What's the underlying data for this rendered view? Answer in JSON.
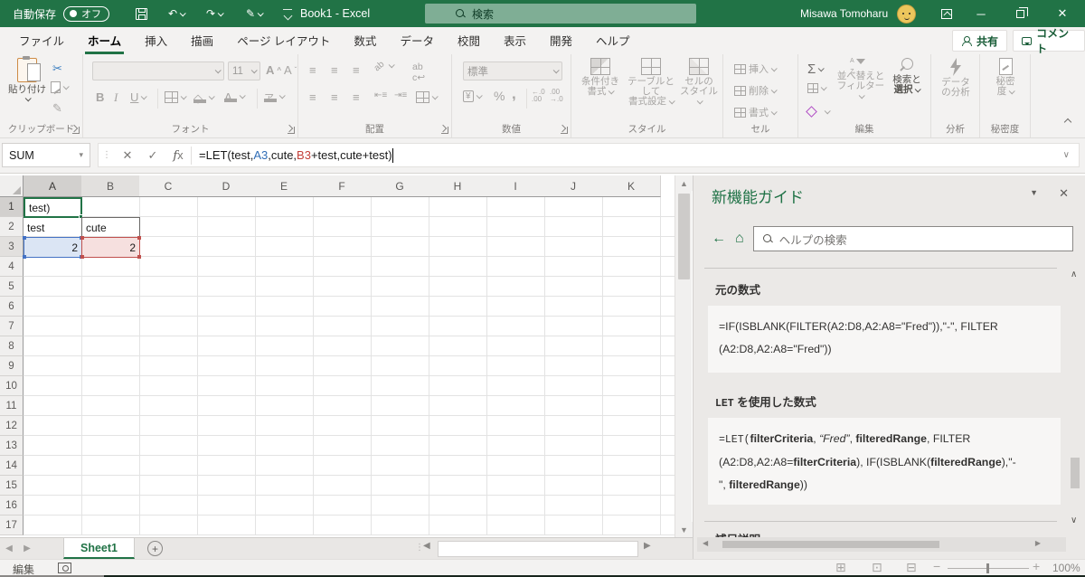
{
  "title_bar": {
    "autosave_label": "自動保存",
    "autosave_state": "オフ",
    "workbook_title": "Book1  -  Excel",
    "search_placeholder": "検索",
    "user_name": "Misawa Tomoharu"
  },
  "tabs": {
    "items": [
      {
        "label": "ファイル",
        "active": false
      },
      {
        "label": "ホーム",
        "active": true
      },
      {
        "label": "挿入",
        "active": false
      },
      {
        "label": "描画",
        "active": false
      },
      {
        "label": "ページ レイアウト",
        "active": false
      },
      {
        "label": "数式",
        "active": false
      },
      {
        "label": "データ",
        "active": false
      },
      {
        "label": "校閲",
        "active": false
      },
      {
        "label": "表示",
        "active": false
      },
      {
        "label": "開発",
        "active": false
      },
      {
        "label": "ヘルプ",
        "active": false
      }
    ],
    "share_label": "共有",
    "comments_label": "コメント"
  },
  "ribbon": {
    "clipboard": {
      "paste": "貼り付け",
      "label": "クリップボード"
    },
    "font": {
      "size": "11",
      "label": "フォント"
    },
    "alignment": {
      "label": "配置"
    },
    "number": {
      "format": "標準",
      "label": "数値"
    },
    "styles": {
      "b1a": "条件付き",
      "b1b": "書式 ",
      "b2a": "テーブルとして",
      "b2b": "書式設定 ",
      "b3a": "セルの",
      "b3b": "スタイル ",
      "label": "スタイル"
    },
    "cells": {
      "b1": "挿入",
      "b2": "削除",
      "b3": "書式",
      "label": "セル"
    },
    "editing": {
      "b1a": "並べ替えと",
      "b1b": "フィルター ",
      "b2a": "検索と",
      "b2b": "選択 ",
      "label": "編集"
    },
    "analysis": {
      "b1a": "データ",
      "b1b": "の分析",
      "label": "分析"
    },
    "sensitivity": {
      "b1a": "秘密",
      "b1b": "度 ",
      "label": "秘密度"
    }
  },
  "formula_bar": {
    "name_box": "SUM",
    "segments": [
      {
        "t": "=LET(test,"
      },
      {
        "t": "A3",
        "c": "#2f6db6"
      },
      {
        "t": ",cute,"
      },
      {
        "t": "B3",
        "c": "#c4403a"
      },
      {
        "t": "+test,cute+test)"
      }
    ]
  },
  "grid": {
    "columns": [
      "A",
      "B",
      "C",
      "D",
      "E",
      "F",
      "G",
      "H",
      "I",
      "J",
      "K"
    ],
    "rows": [
      "1",
      "2",
      "3",
      "4",
      "5",
      "6",
      "7",
      "8",
      "9",
      "10",
      "11",
      "12",
      "13",
      "14",
      "15",
      "16",
      "17"
    ],
    "highlight": {
      "cols": [
        "A"
      ],
      "cols2": [
        "B"
      ],
      "rows": [
        "1"
      ],
      "rows2": [
        "3"
      ]
    },
    "cells": [
      {
        "ref": "A1",
        "text": "test)",
        "c": 0,
        "r": 0,
        "style": "active",
        "align": "left"
      },
      {
        "ref": "A2",
        "text": "test",
        "c": 0,
        "r": 1,
        "style": "plain",
        "align": "left"
      },
      {
        "ref": "B2",
        "text": "cute",
        "c": 1,
        "r": 1,
        "style": "dark",
        "align": "left"
      },
      {
        "ref": "A3",
        "text": "2",
        "c": 0,
        "r": 2,
        "style": "refblue",
        "align": "right"
      },
      {
        "ref": "B3",
        "text": "2",
        "c": 1,
        "r": 2,
        "style": "refred",
        "align": "right"
      }
    ]
  },
  "sheet_bar": {
    "tab": "Sheet1"
  },
  "status_bar": {
    "mode": "編集",
    "zoom": "100%"
  },
  "panel": {
    "title": "新機能ガイド",
    "search_placeholder": "ヘルプの検索",
    "section1_heading": "元の数式",
    "code1_lines": [
      "=IF(ISBLANK(FILTER(A2:D8,A2:A8=\"Fred\")),\"-\", FILTER",
      "(A2:D8,A2:A8=\"Fred\"))"
    ],
    "section2_heading": [
      {
        "t": "LET",
        "m": true
      },
      {
        "t": " を使用した数式"
      }
    ],
    "code2_lines": [
      [
        {
          "t": "=LET(",
          "m": true
        },
        {
          "t": "filterCriteria",
          "b": true
        },
        {
          "t": ", "
        },
        {
          "t": "“Fred”",
          "i": true
        },
        {
          "t": ", "
        },
        {
          "t": "filteredRange",
          "b": true
        },
        {
          "t": ", FILTER"
        }
      ],
      [
        {
          "t": "(A2:D8,A2:A8="
        },
        {
          "t": "filterCriteria",
          "b": true
        },
        {
          "t": "), IF(ISBLANK("
        },
        {
          "t": "filteredRange",
          "b": true
        },
        {
          "t": "),\"-"
        }
      ],
      [
        {
          "t": "\", "
        },
        {
          "t": "filteredRange",
          "b": true
        },
        {
          "t": "))"
        }
      ]
    ],
    "section3_heading": "補足説明"
  },
  "colors": {
    "brand_green": "#217346",
    "panel_title_green": "#1e7145",
    "ref_blue": "#2f6db6",
    "ref_red": "#c4403a",
    "ref_blue_fill": "#dbe5f4",
    "ref_red_fill": "#f6e0df"
  }
}
